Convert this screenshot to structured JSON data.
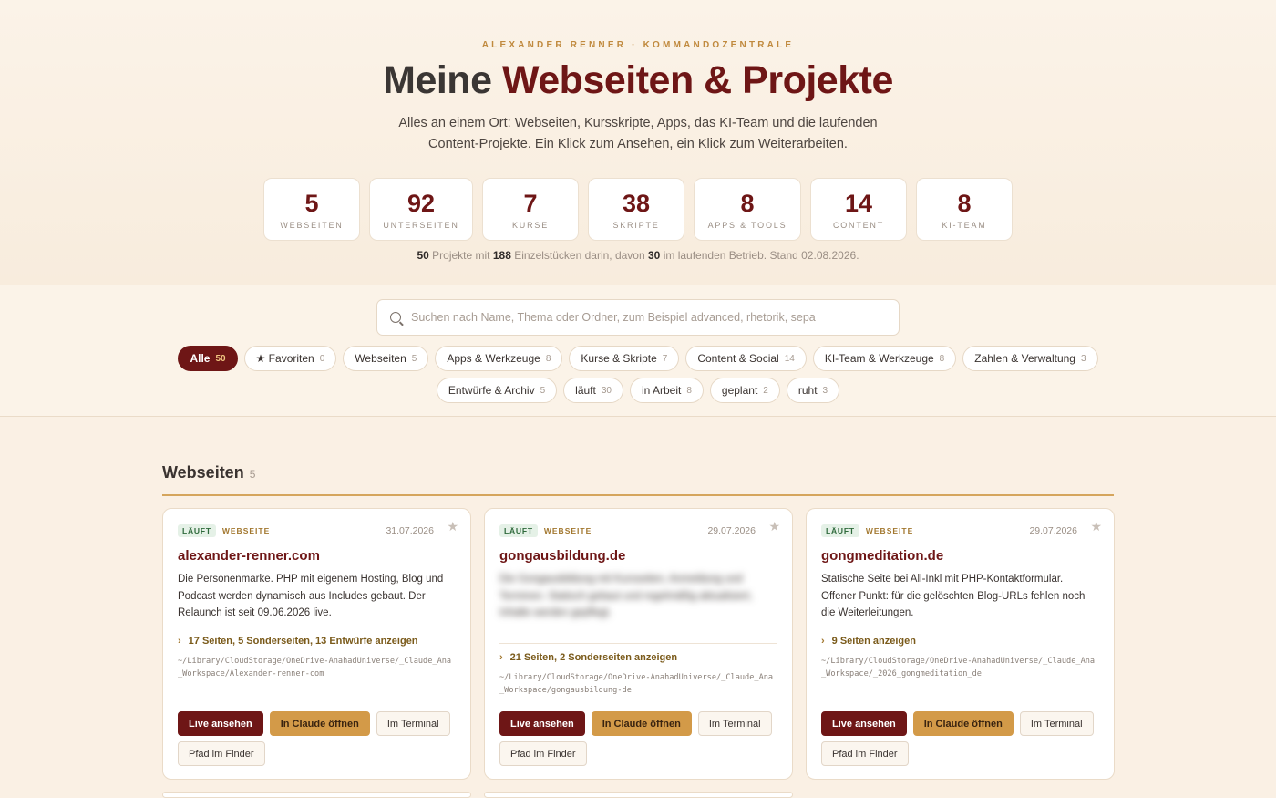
{
  "hero": {
    "eyebrow": "ALEXANDER RENNER · KOMMANDOZENTRALE",
    "title_prefix": "Meine",
    "title_accent": "Webseiten & Projekte",
    "subtitle": "Alles an einem Ort: Webseiten, Kursskripte, Apps, das KI-Team und die laufenden Content-Projekte. Ein Klick zum Ansehen, ein Klick zum Weiterarbeiten.",
    "stats": [
      {
        "value": "5",
        "label": "WEBSEITEN"
      },
      {
        "value": "92",
        "label": "UNTERSEITEN"
      },
      {
        "value": "7",
        "label": "KURSE"
      },
      {
        "value": "38",
        "label": "SKRIPTE"
      },
      {
        "value": "8",
        "label": "APPS & TOOLS"
      },
      {
        "value": "14",
        "label": "CONTENT"
      },
      {
        "value": "8",
        "label": "KI-TEAM"
      }
    ],
    "summary": {
      "projects": "50",
      "t1": "Projekte mit",
      "pieces": "188",
      "t2": "Einzelstücken darin, davon",
      "running": "30",
      "t3": "im laufenden Betrieb. Stand 02.08.2026."
    }
  },
  "search": {
    "placeholder": "Suchen nach Name, Thema oder Ordner, zum Beispiel advanced, rhetorik, sepa"
  },
  "filters": {
    "row1": [
      {
        "label": "Alle",
        "count": "50"
      },
      {
        "label": "★ Favoriten",
        "count": "0"
      },
      {
        "label": "Webseiten",
        "count": "5"
      },
      {
        "label": "Apps & Werkzeuge",
        "count": "8"
      },
      {
        "label": "Kurse & Skripte",
        "count": "7"
      },
      {
        "label": "Content & Social",
        "count": "14"
      },
      {
        "label": "KI-Team & Werkzeuge",
        "count": "8"
      },
      {
        "label": "Zahlen & Verwaltung",
        "count": "3"
      }
    ],
    "row2": [
      {
        "label": "Entwürfe & Archiv",
        "count": "5"
      },
      {
        "label": "läuft",
        "count": "30"
      },
      {
        "label": "in Arbeit",
        "count": "8"
      },
      {
        "label": "geplant",
        "count": "2"
      },
      {
        "label": "ruht",
        "count": "3"
      }
    ]
  },
  "section": {
    "title": "Webseiten",
    "count": "5"
  },
  "buttons": {
    "live": "Live ansehen",
    "claude": "In Claude öffnen",
    "terminal": "Im Terminal",
    "finder": "Pfad im Finder"
  },
  "cards": [
    {
      "status": "LÄUFT",
      "type": "WEBSEITE",
      "date": "31.07.2026",
      "title": "alexander-renner.com",
      "desc": "Die Personenmarke. PHP mit eigenem Hosting, Blog und Podcast werden dynamisch aus Includes gebaut. Der Relaunch ist seit 09.06.2026 live.",
      "expand": "17 Seiten, 5 Sonderseiten, 13 Entwürfe anzeigen",
      "path": "~/Library/CloudStorage/OneDrive-AnahadUniverse/_Claude_Ana_Workspace/Alexander-renner-com"
    },
    {
      "status": "LÄUFT",
      "type": "WEBSEITE",
      "date": "29.07.2026",
      "title": "gongausbildung.de",
      "desc": "Die Gongausbildung mit Kursseiten, Anmeldung und Terminen. Statisch gebaut und regelmäßig aktualisiert, Inhalte werden gepflegt.",
      "expand": "21 Seiten, 2 Sonderseiten anzeigen",
      "path": "~/Library/CloudStorage/OneDrive-AnahadUniverse/_Claude_Ana_Workspace/gongausbildung-de"
    },
    {
      "status": "LÄUFT",
      "type": "WEBSEITE",
      "date": "29.07.2026",
      "title": "gongmeditation.de",
      "desc": "Statische Seite bei All-Inkl mit PHP-Kontaktformular. Offener Punkt: für die gelöschten Blog-URLs fehlen noch die Weiterleitungen.",
      "expand": "9 Seiten anzeigen",
      "path": "~/Library/CloudStorage/OneDrive-AnahadUniverse/_Claude_Ana_Workspace/_2026_gongmeditation_de"
    }
  ]
}
